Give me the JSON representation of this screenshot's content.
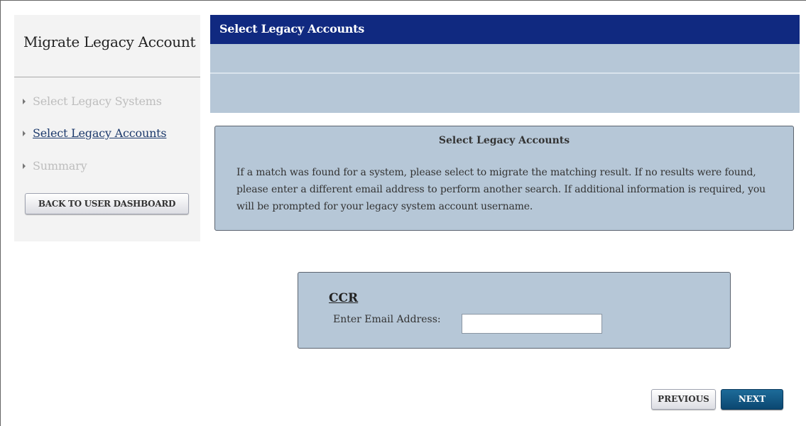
{
  "sidebar": {
    "title": "Migrate Legacy Account",
    "items": [
      {
        "label": "Select Legacy Systems",
        "state": "completed"
      },
      {
        "label": "Select Legacy Accounts",
        "state": "active"
      },
      {
        "label": "Summary",
        "state": "pending"
      }
    ],
    "back_button_label": "BACK TO USER DASHBOARD"
  },
  "header": {
    "title": "Select Legacy Accounts"
  },
  "info": {
    "title": "Select Legacy Accounts",
    "text": "If a match was found for a system, please select to migrate the matching result. If no results were found, please enter a different email address to perform another search. If additional information is required, you will be prompted for your legacy system account username."
  },
  "ccr": {
    "system_name": "CCR",
    "email_label": "Enter Email Address:",
    "email_value": ""
  },
  "footer": {
    "previous_label": "PREVIOUS",
    "next_label": "NEXT"
  },
  "colors": {
    "header_bar": "#102980",
    "panel_bg": "#b6c7d7",
    "next_button": "#0b4771",
    "active_link": "#1d3a6c"
  }
}
